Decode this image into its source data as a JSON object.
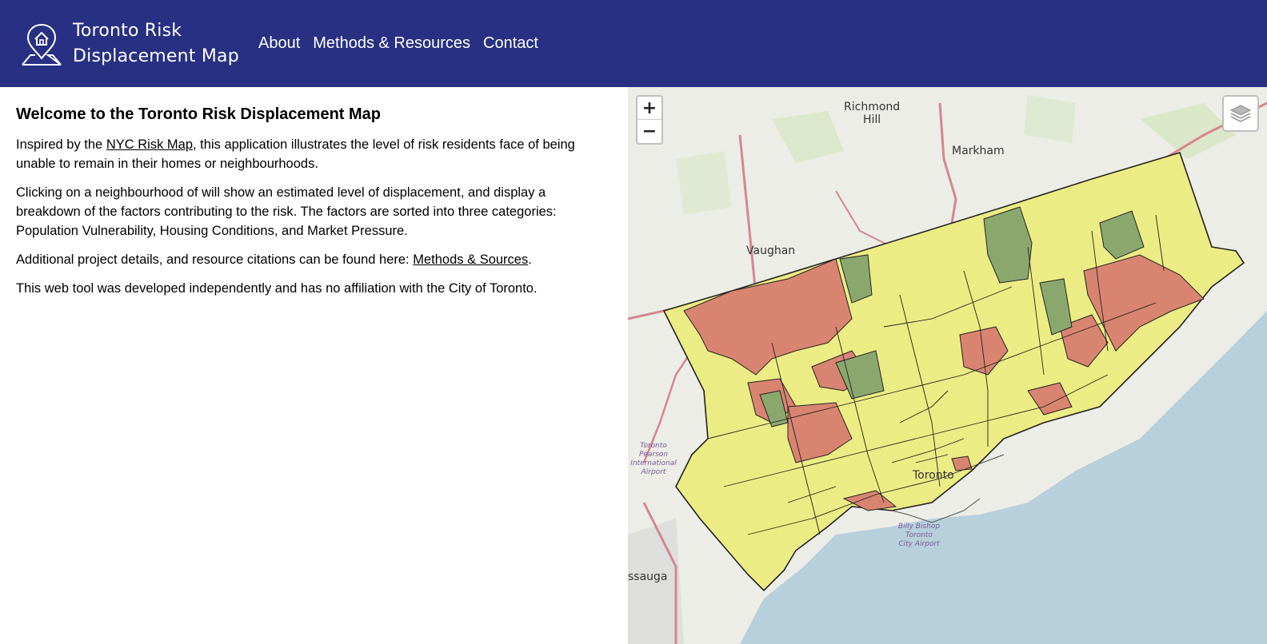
{
  "header": {
    "title": "Toronto Risk Displacement Map",
    "title_line1": "Toronto Risk",
    "title_line2": "Displacement Map",
    "logo_icon": "home-location-pin-icon",
    "nav": [
      {
        "label": "About"
      },
      {
        "label": "Methods & Resources"
      },
      {
        "label": "Contact"
      }
    ],
    "background_color": "#283084"
  },
  "intro": {
    "heading": "Welcome to the Toronto Risk Displacement Map",
    "p1_pre": "Inspired by the ",
    "p1_link": "NYC Risk Map",
    "p1_post": ", this application illustrates the level of risk residents face of being unable to remain in their homes or neighbourhoods.",
    "p2": "Clicking on a neighbourhood of will show an estimated level of displacement, and display a breakdown of the factors contributing to the risk. The factors are sorted into three categories: Population Vulnerability, Housing Conditions, and Market Pressure.",
    "p3_pre": "Additional project details, and resource citations can be found here: ",
    "p3_link": "Methods & Sources",
    "p3_post": ".",
    "p4": "This web tool was developed independently and has no affiliation with the City of Toronto."
  },
  "map": {
    "zoom_in": "+",
    "zoom_out": "−",
    "layers_icon": "layers-icon",
    "labels": {
      "richmond_hill_1": "Richmond",
      "richmond_hill_2": "Hill",
      "markham": "Markham",
      "vaughan": "Vaughan",
      "toronto": "Toronto",
      "mississauga": "ssauga",
      "pearson_1": "Toronto",
      "pearson_2": "Pearson",
      "pearson_3": "International",
      "pearson_4": "Airport",
      "billy_1": "Billy Bishop",
      "billy_2": "Toronto",
      "billy_3": "City Airport"
    },
    "colors": {
      "high_risk": "#d98470",
      "moderate_risk": "#ecec84",
      "low_risk": "#8aa86e",
      "lake": "#b8cfdc",
      "land": "#eeeee9",
      "highway": "#d5868e"
    }
  }
}
